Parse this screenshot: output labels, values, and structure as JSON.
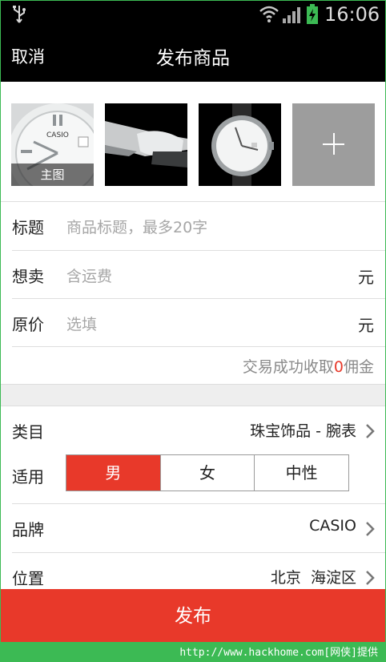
{
  "status_bar": {
    "time": "16:06"
  },
  "header": {
    "cancel_label": "取消",
    "title": "发布商品"
  },
  "photos": {
    "main_label": "主图",
    "items": [
      {
        "name": "watch-closeup"
      },
      {
        "name": "watch-side"
      },
      {
        "name": "watch-front"
      }
    ]
  },
  "form": {
    "title": {
      "label": "标题",
      "placeholder": "商品标题，最多20字"
    },
    "price": {
      "label": "想卖",
      "placeholder": "含运费",
      "unit": "元"
    },
    "original_price": {
      "label": "原价",
      "placeholder": "选填",
      "unit": "元"
    },
    "commission": {
      "prefix": "交易成功收取",
      "amount": "0",
      "suffix": "佣金"
    }
  },
  "details": {
    "category": {
      "label": "类目",
      "value": "珠宝饰品 - 腕表"
    },
    "gender": {
      "label": "适用",
      "options": [
        "男",
        "女",
        "中性"
      ],
      "selected": "男"
    },
    "brand": {
      "label": "品牌",
      "value": "CASIO"
    },
    "location": {
      "label": "位置",
      "value": "北京  海淀区"
    }
  },
  "publish_label": "发布",
  "watermark": "http://www.hackhome.com[网侠]提供",
  "colors": {
    "accent": "#e8392a",
    "frame_green": "#3cba54",
    "bar": "#000000"
  }
}
